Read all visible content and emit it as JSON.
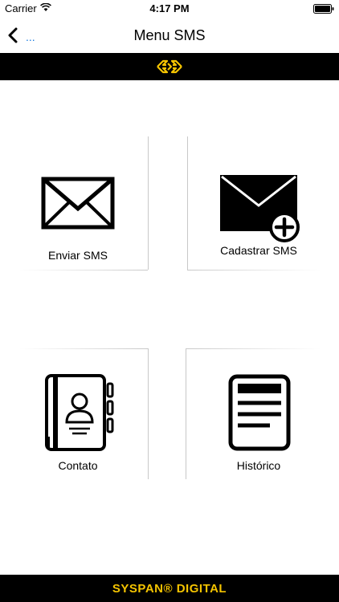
{
  "status_bar": {
    "carrier": "Carrier",
    "time": "4:17 PM"
  },
  "nav": {
    "back_label": "...",
    "title": "Menu SMS"
  },
  "menu": {
    "send_sms": "Enviar SMS",
    "register_sms": "Cadastrar SMS",
    "contact": "Contato",
    "history": "Histórico"
  },
  "footer": {
    "brand": "SYSPAN® DIGITAL"
  },
  "colors": {
    "accent": "#f5c400",
    "link": "#1a7be0",
    "bar": "#000000"
  }
}
